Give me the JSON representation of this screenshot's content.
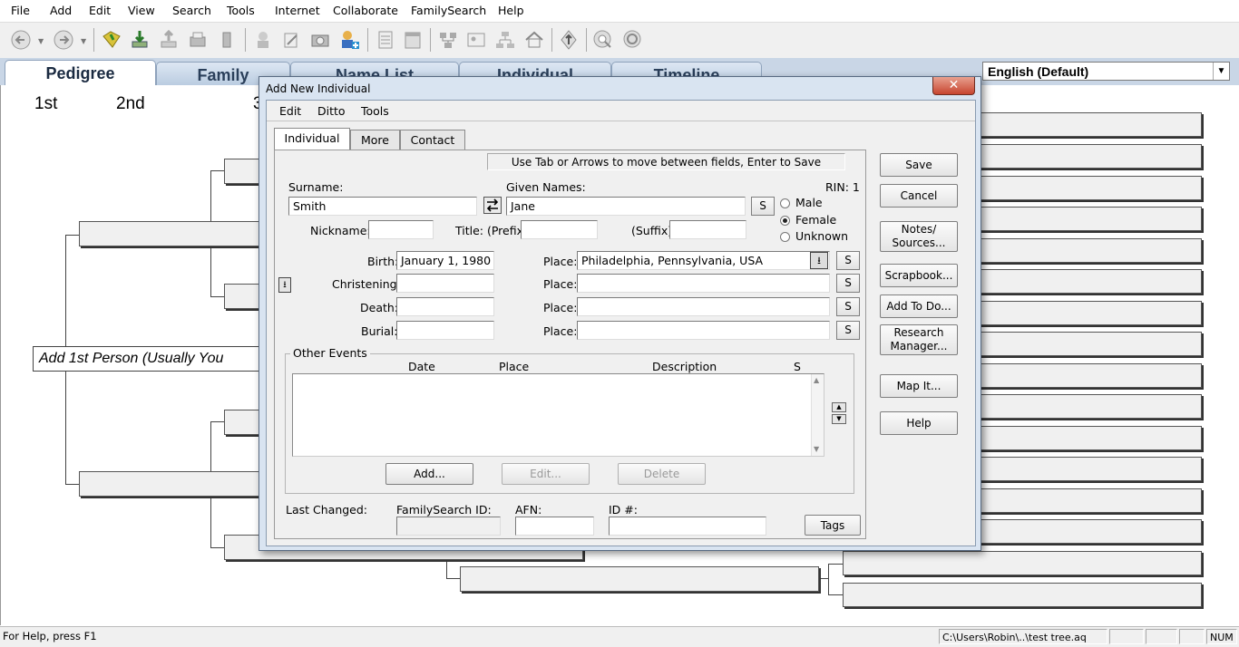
{
  "menubar": {
    "items": [
      "File",
      "Add",
      "Edit",
      "View",
      "Search",
      "Tools",
      "Internet",
      "Collaborate",
      "FamilySearch",
      "Help"
    ]
  },
  "toolbar": {
    "icons": [
      "back-arrow-icon",
      "forward-arrow-icon",
      "open-file-icon",
      "import-icon",
      "export-icon",
      "print-icon",
      "book-icon",
      "contact-icon",
      "edit-note-icon",
      "camera-icon",
      "add-person-icon",
      "list-icon",
      "notebook-icon",
      "family-group-icon",
      "family-card-icon",
      "descendants-icon",
      "home-icon",
      "navigate-icon",
      "find-icon",
      "search-globe-icon"
    ]
  },
  "main_tabs": [
    "Pedigree",
    "Family",
    "Name List",
    "Individual",
    "Timeline"
  ],
  "language_select": {
    "value": "English (Default)"
  },
  "pedigree": {
    "generations": [
      "1st",
      "2nd",
      "3"
    ],
    "root_person": "Add 1st Person (Usually You"
  },
  "statusbar": {
    "help": "For Help, press F1",
    "path": "C:\\Users\\Robin\\..\\test tree.aq",
    "num": "NUM"
  },
  "dialog": {
    "title": "Add New Individual",
    "close": "✕",
    "menu": [
      "Edit",
      "Ditto",
      "Tools"
    ],
    "tabs": [
      "Individual",
      "More",
      "Contact"
    ],
    "hint": "Use Tab or Arrows to move between fields, Enter to Save",
    "rin": "RIN: 1",
    "surname_label": "Surname:",
    "surname": "Smith",
    "given_label": "Given Names:",
    "given": "Jane",
    "s": "S",
    "sex": {
      "options": [
        "Male",
        "Female",
        "Unknown"
      ],
      "selected": "Female"
    },
    "nickname_label": "Nickname:",
    "title_prefix_label": "Title: (Prefix)",
    "suffix_label": "(Suffix)",
    "events": [
      {
        "label": "Birth:",
        "date": "January 1, 1980",
        "place_label": "Place:",
        "place": "Philadelphia, Pennsylvania, USA"
      },
      {
        "label": "Christening:",
        "date": "",
        "place_label": "Place:",
        "place": ""
      },
      {
        "label": "Death:",
        "date": "",
        "place_label": "Place:",
        "place": ""
      },
      {
        "label": "Burial:",
        "date": "",
        "place_label": "Place:",
        "place": ""
      }
    ],
    "other_events": {
      "title": "Other Events",
      "columns": [
        "Date",
        "Place",
        "Description",
        "S"
      ],
      "add": "Add...",
      "edit": "Edit...",
      "delete": "Delete"
    },
    "footer": {
      "last_changed": "Last Changed:",
      "familysearch_id": "FamilySearch ID:",
      "afn": "AFN:",
      "id": "ID #:",
      "tags": "Tags"
    },
    "right_buttons": [
      "Save",
      "Cancel",
      "Notes/ Sources...",
      "Scrapbook...",
      "Add To Do...",
      "Research Manager...",
      "Map It...",
      "Help"
    ]
  }
}
